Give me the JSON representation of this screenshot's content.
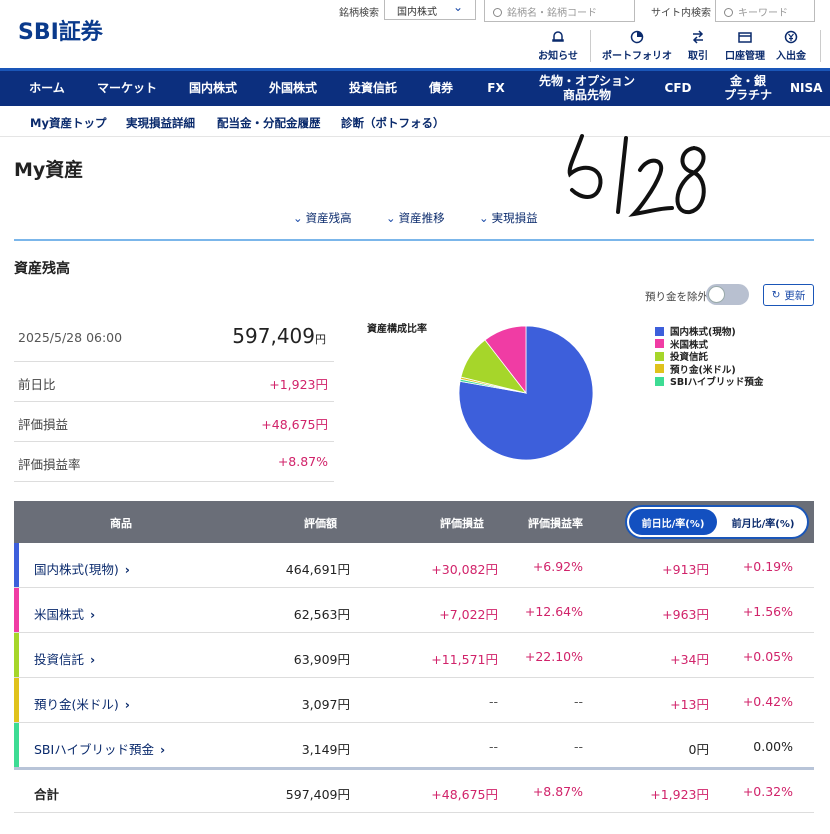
{
  "header": {
    "logo": "SBI証券",
    "stock_search_label": "銘柄検索",
    "market_select": "国内株式",
    "stock_search_placeholder": "銘柄名・銘柄コード",
    "site_search_label": "サイト内検索",
    "site_search_placeholder": "キーワード",
    "tools": [
      "お知らせ",
      "ポートフォリオ",
      "取引",
      "口座管理",
      "入出金"
    ]
  },
  "nav": [
    "ホーム",
    "マーケット",
    "国内株式",
    "外国株式",
    "投資信託",
    "債券",
    "FX",
    "先物・オプション\n商品先物",
    "CFD",
    "金・銀\nプラチナ",
    "NISA"
  ],
  "subnav": [
    "My資産トップ",
    "実現損益詳細",
    "配当金・分配金履歴",
    "診断（ポトフォる）"
  ],
  "page_title": "My資産",
  "anchors": [
    "資産残高",
    "資産推移",
    "実現損益"
  ],
  "handwritten_note": "5/28",
  "section_title": "資産残高",
  "toggle_label": "預り金を除外",
  "refresh_label": "更新",
  "summary": {
    "date": "2025/5/28 06:00",
    "total": "597,409",
    "total_unit": "円",
    "rows": [
      {
        "label": "前日比",
        "value": "+1,923円"
      },
      {
        "label": "評価損益",
        "value": "+48,675円"
      },
      {
        "label": "評価損益率",
        "value": "+8.87%"
      }
    ]
  },
  "pie_title": "資産構成比率",
  "chart_data": {
    "type": "pie",
    "title": "資産構成比率",
    "labels": [
      "国内株式(現物)",
      "米国株式",
      "投資信託",
      "預り金(米ドル)",
      "SBIハイブリッド預金"
    ],
    "values": [
      464691,
      62563,
      63909,
      3097,
      3149
    ],
    "colors": [
      "#3d5fdb",
      "#f03ca4",
      "#a6d62a",
      "#e0c21c",
      "#3ddc94"
    ],
    "legend": "right"
  },
  "table": {
    "headers": [
      "商品",
      "評価額",
      "評価損益",
      "評価損益率"
    ],
    "seg_on": "前日比/率(%)",
    "seg_off": "前月比/率(%)",
    "rows": [
      {
        "name": "国内株式(現物)",
        "amount": "464,691円",
        "pl": "+30,082円",
        "plr": "+6.92%",
        "dd": "+913円",
        "ddr": "+0.19%"
      },
      {
        "name": "米国株式",
        "amount": "62,563円",
        "pl": "+7,022円",
        "plr": "+12.64%",
        "dd": "+963円",
        "ddr": "+1.56%"
      },
      {
        "name": "投資信託",
        "amount": "63,909円",
        "pl": "+11,571円",
        "plr": "+22.10%",
        "dd": "+34円",
        "ddr": "+0.05%"
      },
      {
        "name": "預り金(米ドル)",
        "amount": "3,097円",
        "pl": "--",
        "plr": "--",
        "dd": "+13円",
        "ddr": "+0.42%"
      },
      {
        "name": "SBIハイブリッド預金",
        "amount": "3,149円",
        "pl": "--",
        "plr": "--",
        "dd": "0円",
        "ddr": "0.00%"
      }
    ],
    "total": {
      "name": "合計",
      "amount": "597,409円",
      "pl": "+48,675円",
      "plr": "+8.87%",
      "dd": "+1,923円",
      "ddr": "+0.32%"
    }
  }
}
